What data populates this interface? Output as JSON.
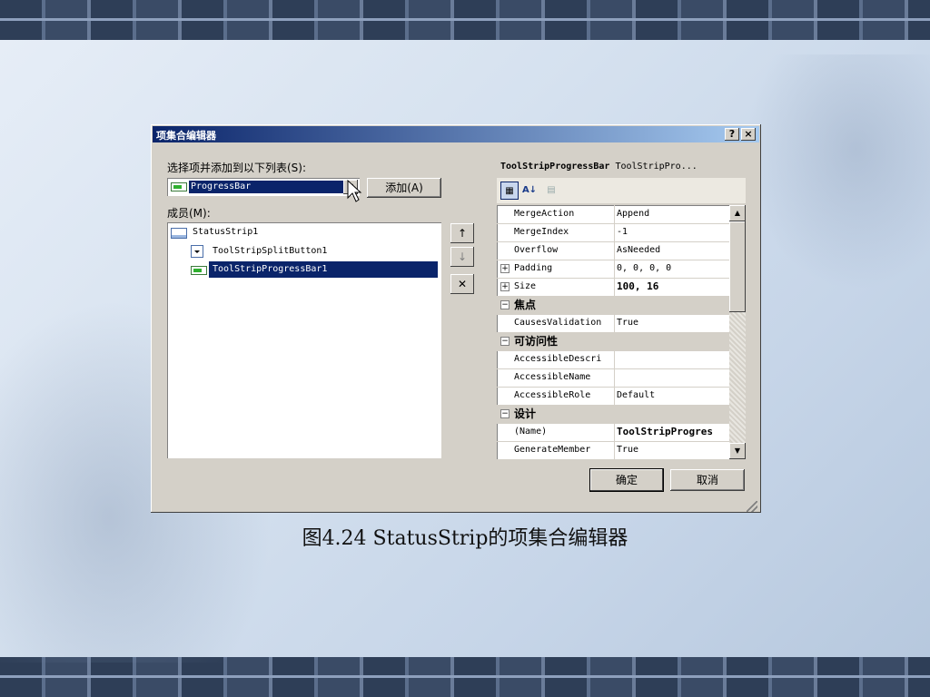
{
  "dialog": {
    "title": "项集合编辑器",
    "help_button": "?",
    "close_button": "×"
  },
  "left": {
    "select_label": "选择项并添加到以下列表(S):",
    "combo_value": "ProgressBar",
    "add_button": "添加(A)",
    "members_label": "成员(M):",
    "members": [
      {
        "label": "StatusStrip1",
        "icon": "statusstrip-icon",
        "selected": false
      },
      {
        "label": "ToolStripSplitButton1",
        "icon": "splitbutton-icon",
        "selected": false
      },
      {
        "label": "ToolStripProgressBar1",
        "icon": "progressbar-icon",
        "selected": true
      }
    ]
  },
  "member_buttons": {
    "up": "↑",
    "down": "↓",
    "remove": "✕"
  },
  "right": {
    "title_bold": "ToolStripProgressBar",
    "title_rest": "ToolStripPro...",
    "properties": [
      {
        "name": "MergeAction",
        "value": "Append",
        "kind": "prop"
      },
      {
        "name": "MergeIndex",
        "value": "-1",
        "kind": "prop"
      },
      {
        "name": "Overflow",
        "value": "AsNeeded",
        "kind": "prop"
      },
      {
        "name": "Padding",
        "value": "0, 0, 0, 0",
        "kind": "expand"
      },
      {
        "name": "Size",
        "value": "100, 16",
        "kind": "expand",
        "bold": true
      },
      {
        "name": "焦点",
        "value": "",
        "kind": "category"
      },
      {
        "name": "CausesValidation",
        "value": "True",
        "kind": "prop"
      },
      {
        "name": "可访问性",
        "value": "",
        "kind": "category"
      },
      {
        "name": "AccessibleDescri",
        "value": "",
        "kind": "prop"
      },
      {
        "name": "AccessibleName",
        "value": "",
        "kind": "prop"
      },
      {
        "name": "AccessibleRole",
        "value": "Default",
        "kind": "prop"
      },
      {
        "name": "设计",
        "value": "",
        "kind": "category"
      },
      {
        "name": "(Name)",
        "value": "ToolStripProgres",
        "kind": "prop",
        "bold": true
      },
      {
        "name": "GenerateMember",
        "value": "True",
        "kind": "prop"
      }
    ]
  },
  "footer": {
    "ok_button": "确定",
    "cancel_button": "取消"
  },
  "caption": "图4.24 StatusStrip的项集合编辑器"
}
